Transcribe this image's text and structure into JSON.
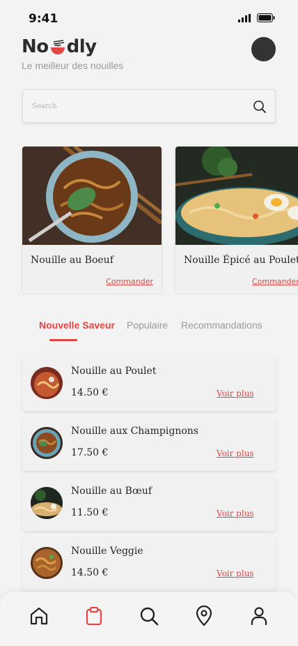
{
  "status_bar": {
    "time": "9:41"
  },
  "brand": {
    "logo_prefix": "No",
    "logo_suffix": "dly",
    "tagline": "Le meilleur des nouilles"
  },
  "search": {
    "placeholder": "Search",
    "value": ""
  },
  "featured": [
    {
      "name": "Nouille au Boeuf",
      "cta": "Commander"
    },
    {
      "name": "Nouille Épicé au Poulet",
      "cta": "Commander"
    }
  ],
  "tabs": [
    "Nouvelle Saveur",
    "Populaire",
    "Recommandations"
  ],
  "active_tab": 0,
  "items": [
    {
      "name": "Nouille au Poulet",
      "price": "14.50 €",
      "link": "Voir plus"
    },
    {
      "name": "Nouille aux Champignons",
      "price": "17.50 €",
      "link": "Voir plus"
    },
    {
      "name": "Nouille au Bœuf",
      "price": "11.50 €",
      "link": "Voir plus"
    },
    {
      "name": "Nouille Veggie",
      "price": "14.50 €",
      "link": "Voir plus"
    }
  ],
  "nav": [
    "home-icon",
    "clipboard-icon",
    "search-icon",
    "location-pin-icon",
    "user-icon"
  ],
  "colors": {
    "accent": "#e34545",
    "text": "#222222",
    "muted": "#9a9a9a",
    "background": "#f3f3f3"
  }
}
